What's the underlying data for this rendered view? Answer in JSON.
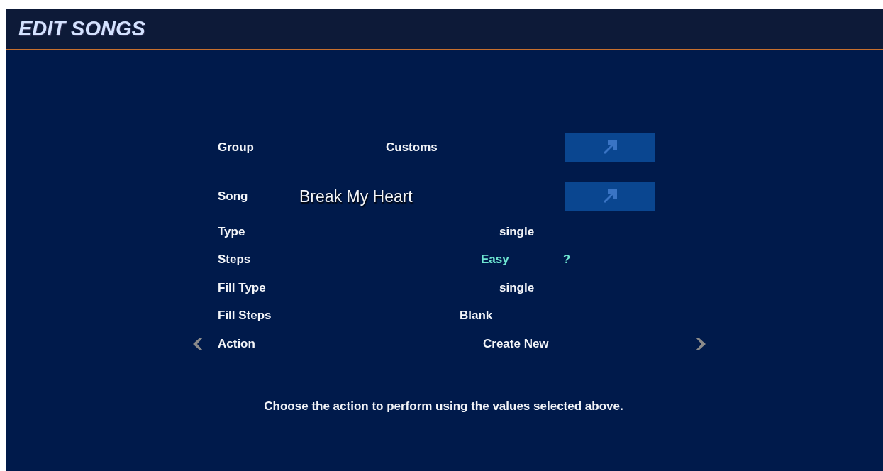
{
  "header": {
    "title": "EDIT SONGS"
  },
  "rows": [
    {
      "kind": "picker",
      "label": "Group",
      "value": "Customs",
      "selected": false
    },
    {
      "kind": "title",
      "label": "Song",
      "value": "Break My Heart",
      "selected": false
    },
    {
      "kind": "value",
      "label": "Type",
      "value": "single",
      "selected": false
    },
    {
      "kind": "difficulty",
      "label": "Steps",
      "value": "Easy",
      "meter": "?",
      "color": "#6ee6d2",
      "selected": false
    },
    {
      "kind": "value",
      "label": "Fill Type",
      "value": "single",
      "selected": false
    },
    {
      "kind": "value",
      "label": "Fill Steps",
      "value": "Blank",
      "selected": false
    },
    {
      "kind": "value",
      "label": "Action",
      "value": "Create New",
      "selected": true
    }
  ],
  "hint": "Choose the action to perform using the values selected above."
}
